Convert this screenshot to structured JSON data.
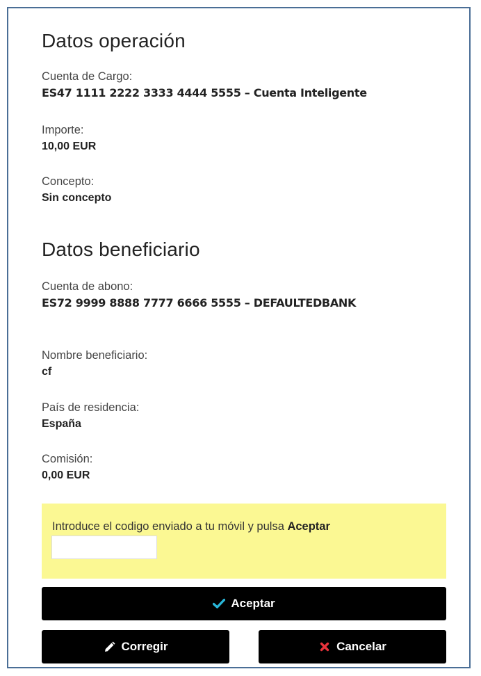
{
  "operacion": {
    "title": "Datos operación",
    "cuenta_cargo_label": "Cuenta de Cargo:",
    "cuenta_cargo_value": "ES47 1111 2222 3333 4444 5555 – Cuenta Inteligente",
    "importe_label": "Importe:",
    "importe_value": "10,00 EUR",
    "concepto_label": "Concepto:",
    "concepto_value": "Sin concepto"
  },
  "beneficiario": {
    "title": "Datos beneficiario",
    "cuenta_abono_label": "Cuenta de abono:",
    "cuenta_abono_value": "ES72 9999 8888 7777 6666 5555  – DEFAULTEDBANK",
    "nombre_label": "Nombre beneficiario:",
    "nombre_value": "cf",
    "pais_label": "País de residencia:",
    "pais_value": "España",
    "comision_label": "Comisión:",
    "comision_value": "0,00 EUR"
  },
  "otp": {
    "instruction": "Introduce el codigo enviado a tu móvil y pulsa ",
    "instruction_bold": "Aceptar",
    "input_value": "",
    "input_placeholder": ""
  },
  "buttons": {
    "accept_label": "Aceptar",
    "edit_label": "Corregir",
    "cancel_label": "Cancelar"
  },
  "icons": {
    "accept": "check-icon",
    "edit": "pencil-icon",
    "cancel": "x-icon"
  },
  "colors": {
    "frame_border": "#4a6e96",
    "otp_background": "#fbf893",
    "button_background": "#000000",
    "check_color": "#29b6d8",
    "cancel_x_color": "#e8333b"
  }
}
